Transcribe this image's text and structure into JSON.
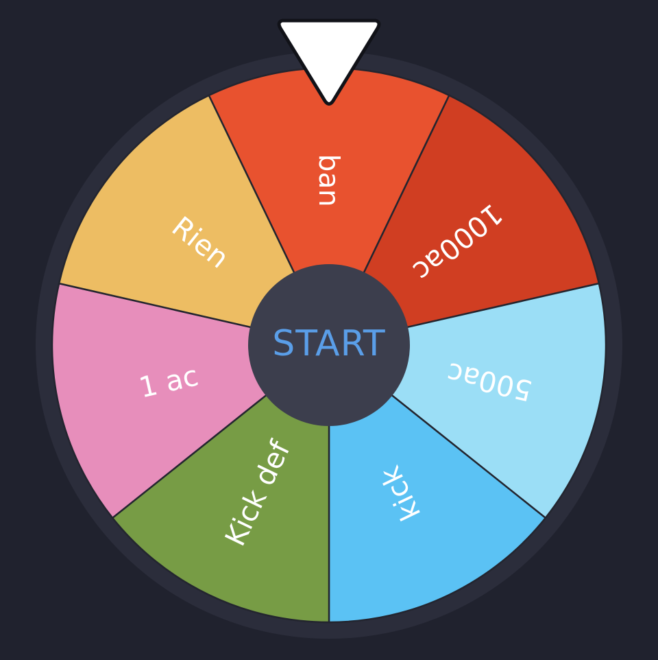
{
  "wheel": {
    "background_color": "#20222e",
    "rim_color": "#2b2d3b",
    "segments": [
      {
        "label": "ban",
        "color": "#e8522f"
      },
      {
        "label": "1000ac",
        "color": "#d03e22"
      },
      {
        "label": "500ac",
        "color": "#9bdef6"
      },
      {
        "label": "kick",
        "color": "#5bc2f4"
      },
      {
        "label": "Kick def",
        "color": "#779c45"
      },
      {
        "label": "1 ac",
        "color": "#e78ebb"
      },
      {
        "label": "Rien",
        "color": "#edbd63"
      }
    ],
    "start_button": {
      "label": "START",
      "label_color": "#5a9ee8",
      "background": "#3c3e4d"
    },
    "pointer": {
      "icon": "pointer-triangle-icon",
      "color": "#ffffff"
    }
  }
}
